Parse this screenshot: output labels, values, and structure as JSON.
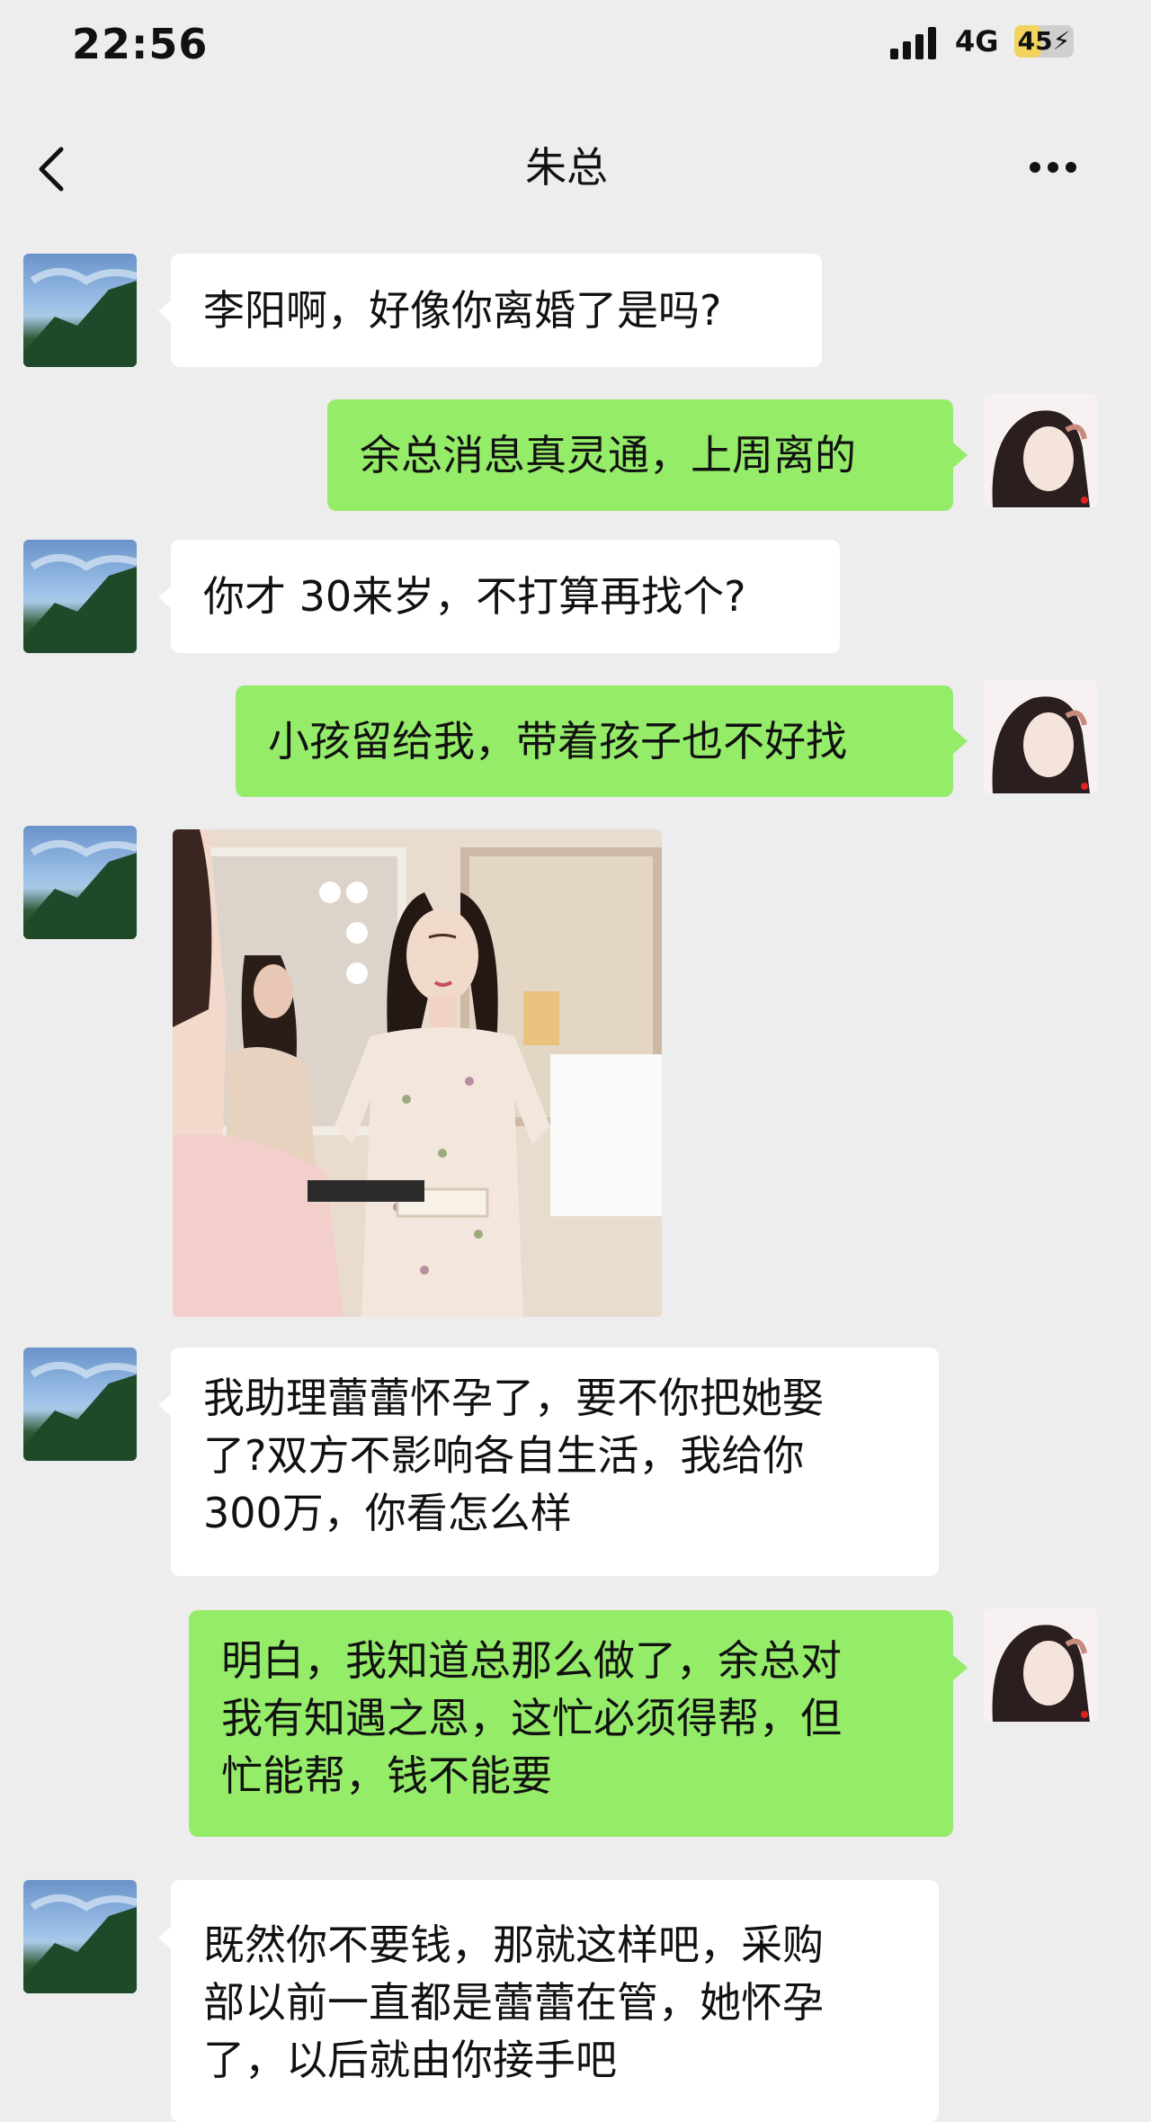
{
  "status_bar": {
    "time": "22:56",
    "network": "4G",
    "battery_percent": 45,
    "battery_label": "45",
    "signal_icon": "signal-bars-icon",
    "battery_icon": "battery-charging-icon"
  },
  "header": {
    "title": "朱总",
    "back_icon": "chevron-left-icon",
    "more_icon": "more-dots-icon"
  },
  "colors": {
    "background": "#ededed",
    "incoming_bubble": "#ffffff",
    "outgoing_bubble": "#95ec69"
  },
  "messages": [
    {
      "side": "left",
      "type": "text",
      "text": "李阳啊，好像你离婚了是吗?"
    },
    {
      "side": "right",
      "type": "text",
      "text": "余总消息真灵通，上周离的"
    },
    {
      "side": "left",
      "type": "text",
      "text": "你才 30来岁，不打算再找个?"
    },
    {
      "side": "right",
      "type": "text",
      "text": "小孩留给我，带着孩子也不好找"
    },
    {
      "side": "left",
      "type": "image",
      "image_desc": "photo"
    },
    {
      "side": "left",
      "type": "text",
      "lines": [
        "我助理蕾蕾怀孕了，要不你把她娶",
        "了?双方不影响各自生活，我给你",
        "300万，你看怎么样"
      ]
    },
    {
      "side": "right",
      "type": "text",
      "lines": [
        "明白，我知道总那么做了，余总对",
        "我有知遇之恩，这忙必须得帮，但",
        "忙能帮，钱不能要"
      ]
    },
    {
      "side": "left",
      "type": "text",
      "lines": [
        "既然你不要钱，那就这样吧，采购",
        "部以前一直都是蕾蕾在管，她怀孕",
        "了，以后就由你接手吧"
      ]
    }
  ]
}
